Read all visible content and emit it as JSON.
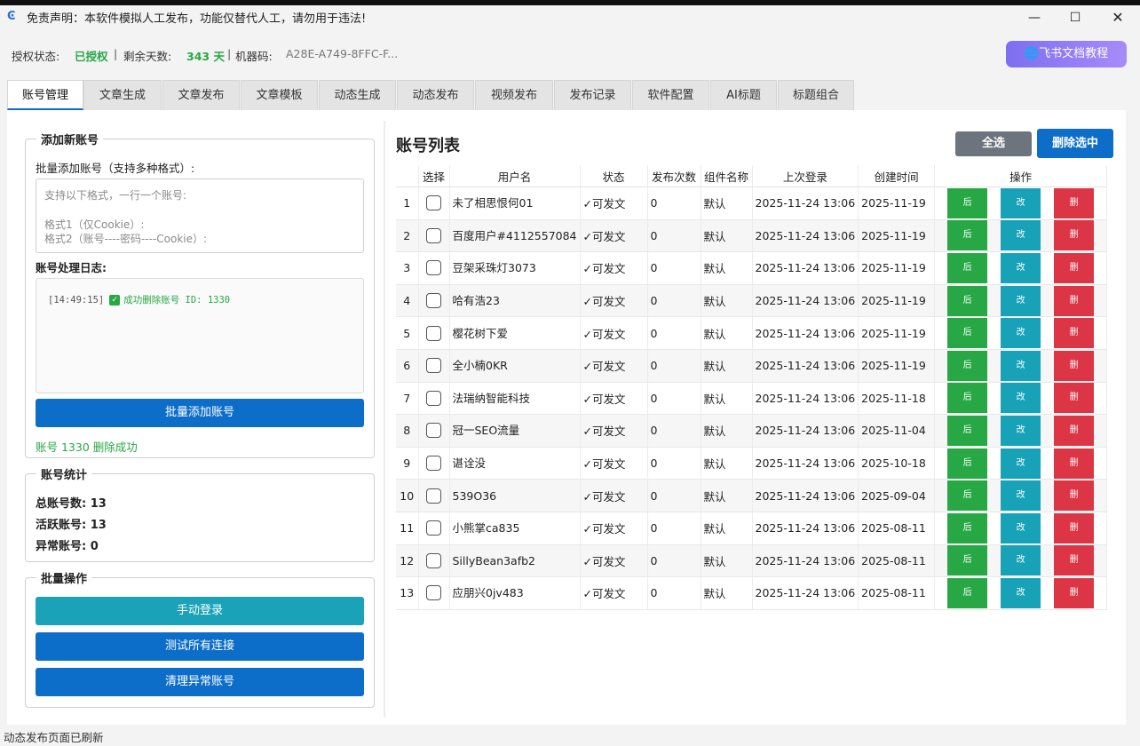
{
  "window": {
    "title": "免责声明：本软件模拟人工发布，功能仅替代人工，请勿用于违法!",
    "minimize_glyph": "—",
    "maximize_glyph": "☐",
    "close_glyph": "✕"
  },
  "status": {
    "auth_label": "授权状态:",
    "auth_value": "已授权",
    "separator": "|",
    "days_label": "剩余天数:",
    "days_value": "343 天",
    "machine_label": "机器码:",
    "machine_value": "A28E-A749-8FFC-F..."
  },
  "feishu_button": "🌐飞书文档教程",
  "tabs": [
    "账号管理",
    "文章生成",
    "文章发布",
    "文章模板",
    "动态生成",
    "动态发布",
    "视频发布",
    "发布记录",
    "软件配置",
    "AI标题",
    "标题组合"
  ],
  "add_account": {
    "group_title": "添加新账号",
    "batch_label": "批量添加账号（支持多种格式）:",
    "placeholder_lines": [
      "支持以下格式，一行一个账号:",
      "格式1（仅Cookie）:",
      "格式2（账号----密码----Cookie）:"
    ],
    "log_label": "账号处理日志:",
    "log_time": "[14:49:15]",
    "log_message": "成功删除账号 ID: 1330",
    "batch_button": "批量添加账号",
    "result_text": "账号 1330 删除成功"
  },
  "stats": {
    "group_title": "账号统计",
    "total": "总账号数: 13",
    "active": "活跃账号: 13",
    "abnormal": "异常账号: 0"
  },
  "batch_ops": {
    "group_title": "批量操作",
    "manual_login": "手动登录",
    "test_all": "测试所有连接",
    "clean_abnormal": "清理异常账号"
  },
  "account_list": {
    "title": "账号列表",
    "select_all": "全选",
    "delete_selected": "删除选中",
    "headers": [
      "",
      "选择",
      "用户名",
      "状态",
      "发布次数",
      "组件名称",
      "上次登录",
      "创建时间",
      "操作"
    ],
    "op_labels": [
      "后",
      "改",
      "删"
    ],
    "rows": [
      {
        "idx": "1",
        "user": "未了相思恨何01",
        "status": "✓可发文",
        "count": "0",
        "component": "默认",
        "last_login": "2025-11-24 13:06",
        "created": "2025-11-19"
      },
      {
        "idx": "2",
        "user": "百度用户#4112557084",
        "status": "✓可发文",
        "count": "0",
        "component": "默认",
        "last_login": "2025-11-24 13:06",
        "created": "2025-11-19"
      },
      {
        "idx": "3",
        "user": "豆架采珠灯3073",
        "status": "✓可发文",
        "count": "0",
        "component": "默认",
        "last_login": "2025-11-24 13:06",
        "created": "2025-11-19"
      },
      {
        "idx": "4",
        "user": "哈有浩23",
        "status": "✓可发文",
        "count": "0",
        "component": "默认",
        "last_login": "2025-11-24 13:06",
        "created": "2025-11-19"
      },
      {
        "idx": "5",
        "user": "樱花树下爱",
        "status": "✓可发文",
        "count": "0",
        "component": "默认",
        "last_login": "2025-11-24 13:06",
        "created": "2025-11-19"
      },
      {
        "idx": "6",
        "user": "全小楠0KR",
        "status": "✓可发文",
        "count": "0",
        "component": "默认",
        "last_login": "2025-11-24 13:06",
        "created": "2025-11-19"
      },
      {
        "idx": "7",
        "user": "法瑞纳智能科技",
        "status": "✓可发文",
        "count": "0",
        "component": "默认",
        "last_login": "2025-11-24 13:06",
        "created": "2025-11-18"
      },
      {
        "idx": "8",
        "user": "冠一SEO流量",
        "status": "✓可发文",
        "count": "0",
        "component": "默认",
        "last_login": "2025-11-24 13:06",
        "created": "2025-11-04"
      },
      {
        "idx": "9",
        "user": "谌诠没",
        "status": "✓可发文",
        "count": "0",
        "component": "默认",
        "last_login": "2025-11-24 13:06",
        "created": "2025-10-18"
      },
      {
        "idx": "10",
        "user": "539O36",
        "status": "✓可发文",
        "count": "0",
        "component": "默认",
        "last_login": "2025-11-24 13:06",
        "created": "2025-09-04"
      },
      {
        "idx": "11",
        "user": "小熊掌ca835",
        "status": "✓可发文",
        "count": "0",
        "component": "默认",
        "last_login": "2025-11-24 13:06",
        "created": "2025-08-11"
      },
      {
        "idx": "12",
        "user": "SillyBean3afb2",
        "status": "✓可发文",
        "count": "0",
        "component": "默认",
        "last_login": "2025-11-24 13:06",
        "created": "2025-08-11"
      },
      {
        "idx": "13",
        "user": "应朋兴0jv483",
        "status": "✓可发文",
        "count": "0",
        "component": "默认",
        "last_login": "2025-11-24 13:06",
        "created": "2025-08-11"
      }
    ]
  },
  "bottom_status": "动态发布页面已刷新",
  "colors": {
    "primary_blue": "#0d6ec9",
    "success_green": "#28a745",
    "danger_red": "#dc3545",
    "info_teal": "#17a2b8",
    "gray": "#6c757d",
    "feishu_purple": "#8b7cf6"
  },
  "icons": {
    "app": "app-logo-icon",
    "log_status": "check-square-icon",
    "feishu": "globe-icon"
  }
}
